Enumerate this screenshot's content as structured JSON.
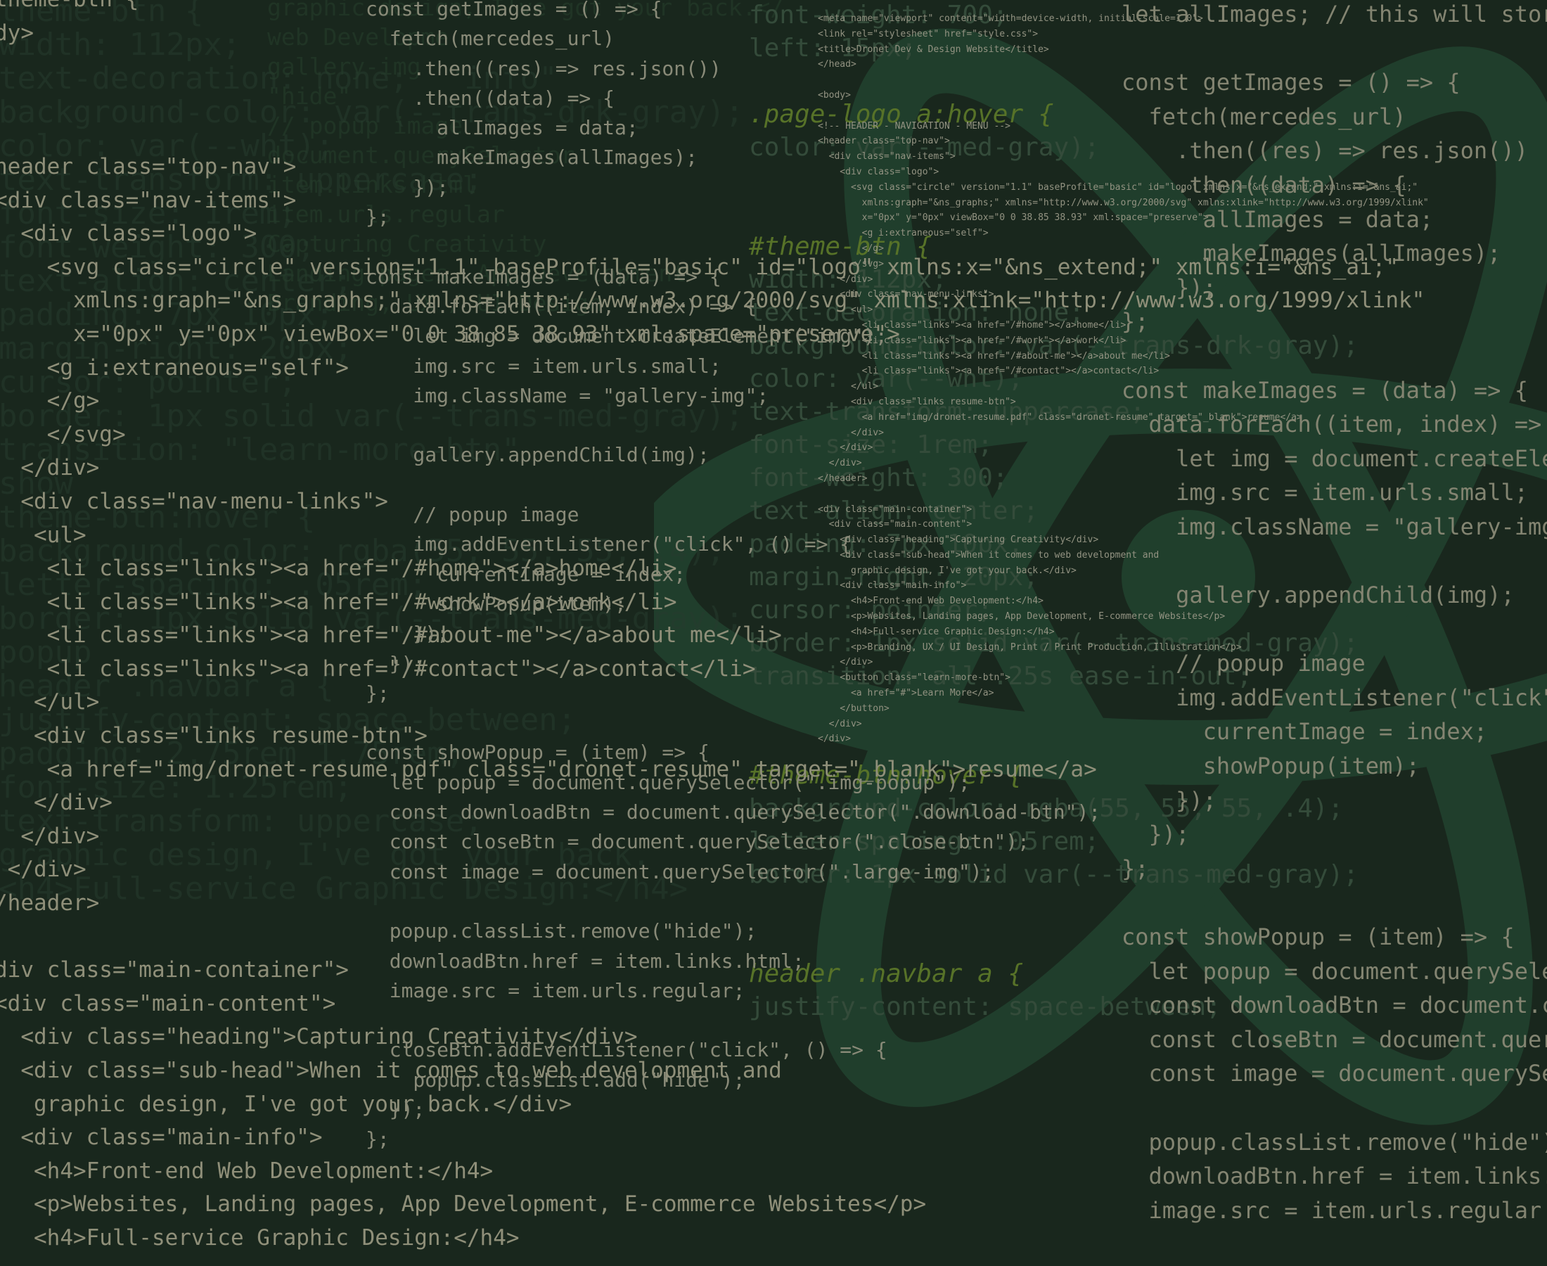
{
  "colors": {
    "background": "#1b2a1f",
    "atom": "#2f6a48",
    "text": "#b9b49a",
    "keyword": "#c7c0a2",
    "attribute": "#9fb24c",
    "selector": "#8ea534"
  },
  "icons": [
    "atom-logo-icon"
  ],
  "background_big": [
    "theme-btn {",
    "width: 112px;",
    "text-decoration: none;  \"info\"",
    "background-color: var(--trans-drk-gray);",
    "color: var(--wht);",
    "text-transform: uppercase;",
    "font-size: 1rem;",
    "font-weight: 300;",
    "text-align: center;",
    "padding: 7px 10px;",
    "margin-right: 20px;",
    "cursor: pointer;",
    "border: 1px solid var(--trans-med-gray);",
    "transition: \"learn-more-btn\"",
    "show",
    "theme-btn:hover {",
    "background-color: rgba(55, 55, 55, .4);",
    "letter-spacing: .05rem;",
    "border: 1px solid var(--trans-med-gray);",
    "popup",
    "header .navbar a {",
    "justify-content: space-between;",
    "padding: 2.75rem 1.75rem;",
    "font-size: 1.25rem;",
    "text-transform: uppercase;",
    "graphic design, I've got your back.",
    "<h4>Full-service Graphic Design:</h4>"
  ],
  "background_mid": [
    "graphic design, I've got your back.</",
    "web Developme",
    "gallery-img",
    "\"hide\"",
    "// popup image",
    "document.querySelector",
    "item.links.html",
    "item.urls.regular",
    "Capturing Creativity",
    "Landing pages, App Development",
    "Branding, UX / UI Design"
  ],
  "left_html": [
    "theme-btn {",
    "dy>",
    "",
    "",
    "",
    "header class=\"top-nav\">",
    "<div class=\"nav-items\">",
    "  <div class=\"logo\">",
    "    <svg class=\"circle\" version=\"1.1\" baseProfile=\"basic\" id=\"logo\" xmlns:x=\"&ns_extend;\" xmlns:i=\"&ns_ai;\"",
    "      xmlns:graph=\"&ns_graphs;\" xmlns=\"http://www.w3.org/2000/svg\" xmlns:xlink=\"http://www.w3.org/1999/xlink\"",
    "      x=\"0px\" y=\"0px\" viewBox=\"0 0 38.85 38.93\" xml:space=\"preserve\">",
    "    <g i:extraneous=\"self\">",
    "    </g>",
    "    </svg>",
    "  </div>",
    "  <div class=\"nav-menu-links\">",
    "   <ul>",
    "    <li class=\"links\"><a href=\"/#home\"></a>home</li>",
    "    <li class=\"links\"><a href=\"/#work\"></a>work</li>",
    "    <li class=\"links\"><a href=\"/#about-me\"></a>about me</li>",
    "    <li class=\"links\"><a href=\"/#contact\"></a>contact</li>",
    "   </ul>",
    "   <div class=\"links resume-btn\">",
    "    <a href=\"img/dronet-resume.pdf\" class=\"dronet-resume\" target=\"_blank\">resume</a>",
    "   </div>",
    "  </div>",
    " </div>",
    "/header>",
    "",
    "div class=\"main-container\">",
    "<div class=\"main-content\">",
    "  <div class=\"heading\">Capturing Creativity</div>",
    "  <div class=\"sub-head\">When it comes to web development and",
    "   graphic design, I've got your back.</div>",
    "  <div class=\"main-info\">",
    "   <h4>Front-end Web Development:</h4>",
    "   <p>Websites, Landing pages, App Development, E-commerce Websites</p>",
    "   <h4>Full-service Graphic Design:</h4>"
  ],
  "center_js": [
    "const getImages = () => {",
    "  fetch(mercedes_url)",
    "    .then((res) => res.json())",
    "    .then((data) => {",
    "      allImages = data;",
    "      makeImages(allImages);",
    "    });",
    "};",
    "",
    "const makeImages = (data) => {",
    "  data.forEach((item, index) => {",
    "    let img = document.createElement(\"img\");",
    "    img.src = item.urls.small;",
    "    img.className = \"gallery-img\";",
    "",
    "    gallery.appendChild(img);",
    "",
    "    // popup image",
    "    img.addEventListener(\"click\", () => {",
    "      currentImage = index;",
    "      showPopup(item);",
    "    });",
    "  });",
    "};",
    "",
    "const showPopup = (item) => {",
    "  let popup = document.querySelector(\".img-popup\");",
    "  const downloadBtn = document.querySelector(\".download-btn\");",
    "  const closeBtn = document.querySelector(\".close-btn\");",
    "  const image = document.querySelector(\".large-img\");",
    "",
    "  popup.classList.remove(\"hide\");",
    "  downloadBtn.href = item.links.html;",
    "  image.src = item.urls.regular;",
    "",
    "  closeBtn.addEventListener(\"click\", () => {",
    "    popup.classList.add(\"hide\");",
    "  });",
    "};"
  ],
  "small_html": [
    "<meta name=\"viewport\" content=\"width=device-width, initial-scale=1.0\">",
    "<link rel=\"stylesheet\" href=\"style.css\">",
    "<title>Dronet Dev & Design Website</title>",
    "</head>",
    "",
    "<body>",
    "",
    "<!-- HEADER - NAVIGATION - MENU -->",
    "<header class=\"top-nav\">",
    "  <div class=\"nav-items\">",
    "    <div class=\"logo\">",
    "      <svg class=\"circle\" version=\"1.1\" baseProfile=\"basic\" id=\"logo\" xmlns:x=\"&ns_extend;\" xmlns:i=\"&ns_ai;\"",
    "        xmlns:graph=\"&ns_graphs;\" xmlns=\"http://www.w3.org/2000/svg\" xmlns:xlink=\"http://www.w3.org/1999/xlink\"",
    "        x=\"0px\" y=\"0px\" viewBox=\"0 0 38.85 38.93\" xml:space=\"preserve\">",
    "        <g i:extraneous=\"self\">",
    "        </g>",
    "      </svg>",
    "    </div>",
    "    <div class=\"nav-menu-links\">",
    "      <ul>",
    "        <li class=\"links\"><a href=\"/#home\"></a>home</li>",
    "        <li class=\"links\"><a href=\"/#work\"></a>work</li>",
    "        <li class=\"links\"><a href=\"/#about-me\"></a>about me</li>",
    "        <li class=\"links\"><a href=\"/#contact\"></a>contact</li>",
    "      </ul>",
    "      <div class=\"links resume-btn\">",
    "        <a href=\"img/dronet-resume.pdf\" class=\"dronet-resume\" target=\"_blank\">resume</a>",
    "      </div>",
    "    </div>",
    "  </div>",
    "</header>",
    "",
    "<div class=\"main-container\">",
    "  <div class=\"main-content\">",
    "    <div class=\"heading\">Capturing Creativity</div>",
    "    <div class=\"sub-head\">When it comes to web development and",
    "      graphic design, I've got your back.</div>",
    "    <div class=\"main-info\">",
    "      <h4>Front-end Web Development:</h4>",
    "      <p>Websites, Landing pages, App Development, E-commerce Websites</p>",
    "      <h4>Full-service Graphic Design:</h4>",
    "      <p>Branding, UX / UI Design, Print / Print Production, Illustration</p>",
    "    </div>",
    "    <button class=\"learn-more-btn\">",
    "      <a href=\"#\">Learn More</a>",
    "    </button>",
    "  </div>",
    "</div>"
  ],
  "css_mid": [
    "font-weight: 700;",
    "left: 15px;",
    "",
    ".page-logo a:hover {",
    "color: var(--med-gray);",
    "",
    "",
    "#theme-btn {",
    "width: 112px;",
    "text-decoration: none;",
    "background-color: var(--trans-drk-gray);",
    "color: var(--wht);",
    "text-transform: uppercase;",
    "font-size: 1rem;",
    "font-weight: 300;",
    "text-align: center;",
    "padding: 7px 10px;",
    "margin-right: 20px;",
    "cursor: pointer;",
    "border: 1px solid var(--trans-med-gray);",
    "transition: all .25s ease-in-out;",
    "",
    "",
    "#theme-btn:hover {",
    "background-color: rgba(55, 55, 55, .4);",
    "letter-spacing: .05rem;",
    "border: 1px solid var(--trans-med-gray);",
    "",
    "",
    "header .navbar a {",
    "justify-content: space-between;"
  ],
  "right_js": [
    "let allImages; // this will store",
    "",
    "const getImages = () => {",
    "  fetch(mercedes_url)",
    "    .then((res) => res.json())",
    "    .then((data) => {",
    "      allImages = data;",
    "      makeImages(allImages);",
    "    });",
    "};",
    "",
    "const makeImages = (data) => {",
    "  data.forEach((item, index) => {",
    "    let img = document.createEle",
    "    img.src = item.urls.small;",
    "    img.className = \"gallery-img",
    "",
    "    gallery.appendChild(img);",
    "",
    "    // popup image",
    "    img.addEventListener(\"click\"",
    "      currentImage = index;",
    "      showPopup(item);",
    "    });",
    "  });",
    "};",
    "",
    "const showPopup = (item) => {",
    "  let popup = document.querySele",
    "  const downloadBtn = document.c",
    "  const closeBtn = document.quer",
    "  const image = document.querySe",
    "",
    "  popup.classList.remove(\"hide\")",
    "  downloadBtn.href = item.links.",
    "  image.src = item.urls.regular"
  ]
}
